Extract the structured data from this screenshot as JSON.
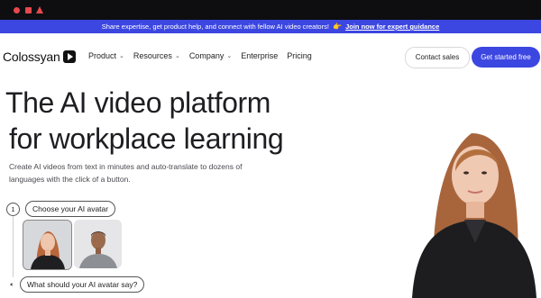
{
  "banner": {
    "text": "Share expertise, get product help, and connect with fellow AI video creators!",
    "emoji": "👉",
    "link": "Join now for expert guidance"
  },
  "nav": {
    "logo_text": "Colossyan",
    "items": [
      {
        "label": "Product",
        "has_caret": true
      },
      {
        "label": "Resources",
        "has_caret": true
      },
      {
        "label": "Company",
        "has_caret": true
      },
      {
        "label": "Enterprise",
        "has_caret": false
      },
      {
        "label": "Pricing",
        "has_caret": false
      }
    ],
    "contact_label": "Contact sales",
    "cta_label": "Get started free"
  },
  "hero": {
    "title_line1": "The AI video platform",
    "title_line2": "for workplace learning",
    "subtitle": "Create AI videos from text in minutes and auto-translate to dozens of languages with the click of a button."
  },
  "steps": {
    "step1_number": "1",
    "step1_label": "Choose your AI avatar",
    "step2_label": "What should your AI avatar say?"
  },
  "icons": {
    "caret": "chevron-down-icon",
    "speaker": "speaker-icon",
    "logo": "play-logo-icon"
  },
  "colors": {
    "accent": "#3c46e0",
    "chrome": "#0e0e10"
  }
}
